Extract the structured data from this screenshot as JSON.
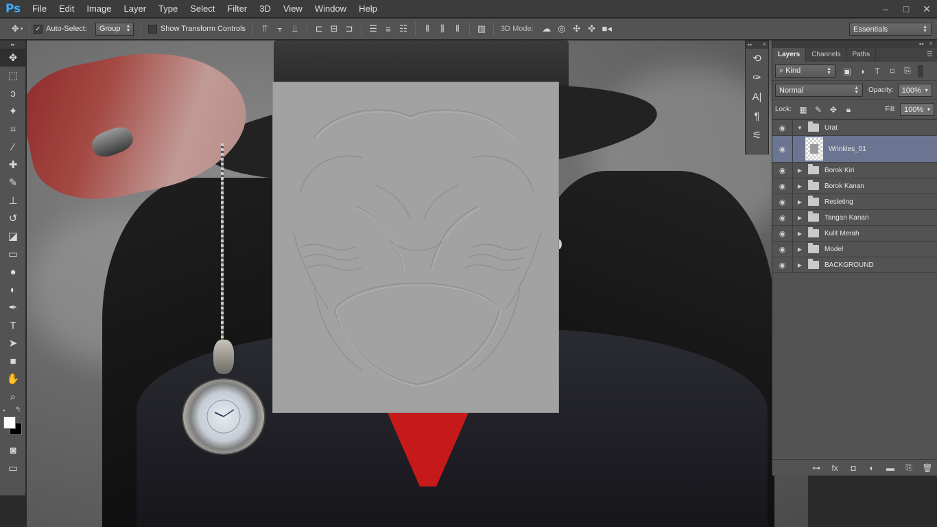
{
  "app": {
    "logo": "Ps"
  },
  "menu": [
    "File",
    "Edit",
    "Image",
    "Layer",
    "Type",
    "Select",
    "Filter",
    "3D",
    "View",
    "Window",
    "Help"
  ],
  "window_controls": {
    "minimize": "–",
    "maximize": "□",
    "close": "✕"
  },
  "options": {
    "auto_select_label": "Auto-Select:",
    "auto_select_checked": true,
    "auto_select_target": "Group",
    "show_transform_label": "Show Transform Controls",
    "show_transform_checked": false,
    "mode_3d_label": "3D Mode:",
    "workspace": "Essentials"
  },
  "tools": [
    {
      "name": "move-tool",
      "glyph": "✥"
    },
    {
      "name": "marquee-tool",
      "glyph": "⬚"
    },
    {
      "name": "lasso-tool",
      "glyph": "ↄ"
    },
    {
      "name": "magic-wand-tool",
      "glyph": "✦"
    },
    {
      "name": "crop-tool",
      "glyph": "⌗"
    },
    {
      "name": "eyedropper-tool",
      "glyph": "⁄"
    },
    {
      "name": "healing-brush-tool",
      "glyph": "✚"
    },
    {
      "name": "brush-tool",
      "glyph": "✎"
    },
    {
      "name": "clone-stamp-tool",
      "glyph": "⊥"
    },
    {
      "name": "history-brush-tool",
      "glyph": "↺"
    },
    {
      "name": "eraser-tool",
      "glyph": "◪"
    },
    {
      "name": "gradient-tool",
      "glyph": "▭"
    },
    {
      "name": "blur-tool",
      "glyph": "●"
    },
    {
      "name": "dodge-tool",
      "glyph": "◐"
    },
    {
      "name": "pen-tool",
      "glyph": "✒"
    },
    {
      "name": "type-tool",
      "glyph": "T"
    },
    {
      "name": "path-selection-tool",
      "glyph": "➤"
    },
    {
      "name": "shape-tool",
      "glyph": "■"
    },
    {
      "name": "hand-tool",
      "glyph": "✋"
    },
    {
      "name": "zoom-tool",
      "glyph": "⌕"
    }
  ],
  "colors": {
    "foreground": "#ffffff",
    "background": "#000000",
    "selection": "#6b7591"
  },
  "layers_panel": {
    "tabs": [
      "Layers",
      "Channels",
      "Paths"
    ],
    "filter_kind": "Kind",
    "blend_mode": "Normal",
    "opacity_label": "Opacity:",
    "opacity": "100%",
    "lock_label": "Lock:",
    "fill_label": "Fill:",
    "fill": "100%",
    "layers": [
      {
        "name": "Urat",
        "type": "group",
        "expanded": true
      },
      {
        "name": "Wrinkles_01",
        "type": "layer",
        "selected": true
      },
      {
        "name": "Borok Kiri",
        "type": "group"
      },
      {
        "name": "Borok Kanan",
        "type": "group"
      },
      {
        "name": "Resleting",
        "type": "group"
      },
      {
        "name": "Tangan Kanan",
        "type": "group"
      },
      {
        "name": "Kulit Merah",
        "type": "group"
      },
      {
        "name": "Model",
        "type": "group"
      },
      {
        "name": "BACKGROUND",
        "type": "group"
      }
    ]
  }
}
